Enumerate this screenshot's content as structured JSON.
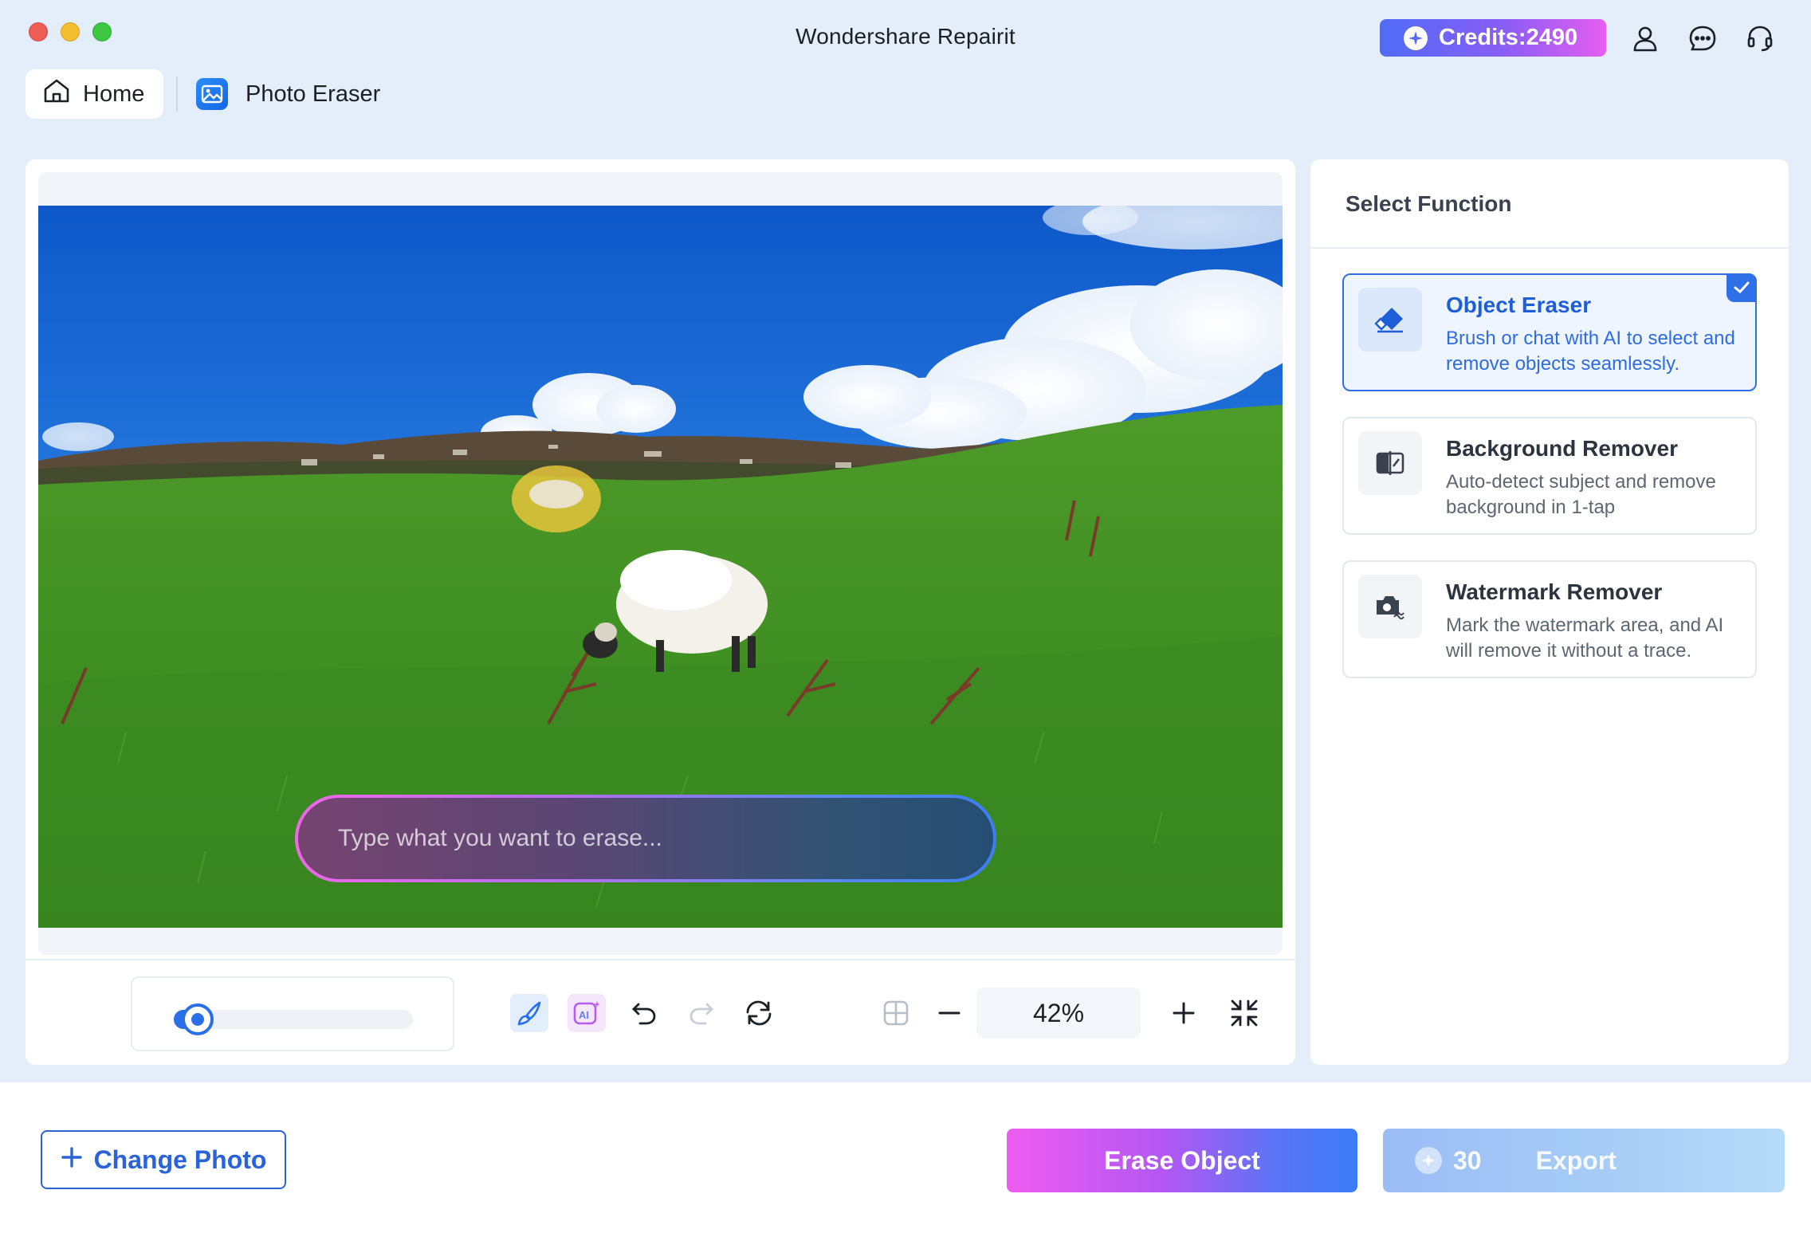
{
  "window": {
    "title": "Wondershare Repairit"
  },
  "header": {
    "credits_label": "Credits:2490",
    "icons": [
      "account-icon",
      "message-icon",
      "support-headset-icon"
    ]
  },
  "nav": {
    "home_label": "Home",
    "tool_label": "Photo Eraser"
  },
  "editor": {
    "prompt_placeholder": "Type what you want to erase...",
    "zoom_label": "42%",
    "brush_size": 0.1
  },
  "functions": {
    "title": "Select Function",
    "items": [
      {
        "title": "Object Eraser",
        "desc": "Brush or chat with AI to select and remove objects seamlessly.",
        "selected": true
      },
      {
        "title": "Background Remover",
        "desc": "Auto-detect subject and remove background in 1-tap",
        "selected": false
      },
      {
        "title": "Watermark Remover",
        "desc": "Mark the watermark area, and AI will remove it without a trace.",
        "selected": false
      }
    ]
  },
  "footer": {
    "change_photo_label": "Change Photo",
    "erase_label": "Erase Object",
    "export_cost": "30",
    "export_label": "Export"
  },
  "colors": {
    "accent": "#2f6fe8",
    "background": "#e3eefa",
    "erase_gradient_start": "#ee5cf0",
    "erase_gradient_end": "#3a7cf7"
  }
}
